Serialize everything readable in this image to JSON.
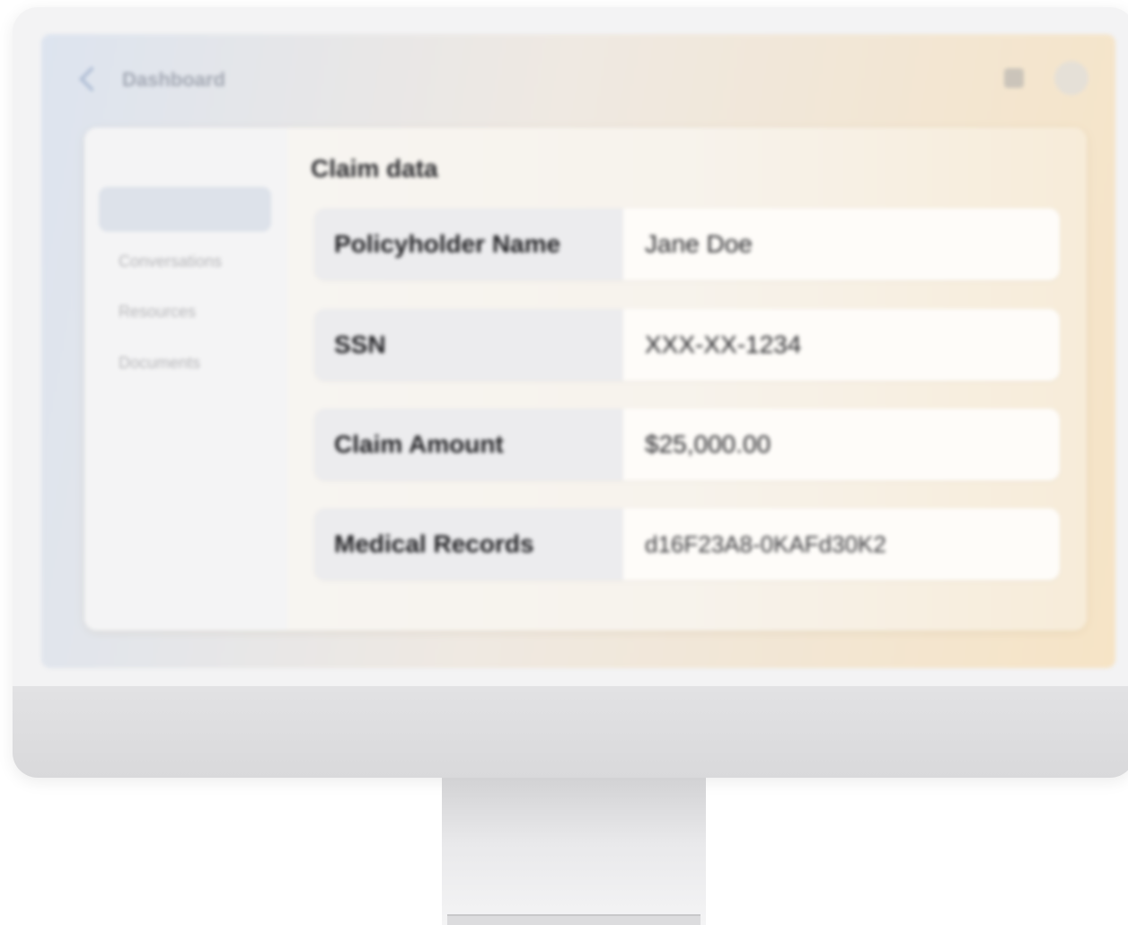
{
  "window": {
    "title": "Dashboard"
  },
  "sidebar": {
    "items": [
      {
        "label": ""
      },
      {
        "label": "Conversations"
      },
      {
        "label": "Resources"
      },
      {
        "label": "Documents"
      }
    ]
  },
  "main": {
    "section_title": "Claim data",
    "rows": [
      {
        "label": "Policyholder Name",
        "value": "Jane Doe"
      },
      {
        "label": "SSN",
        "value": "XXX-XX-1234"
      },
      {
        "label": "Claim Amount",
        "value": "$25,000.00"
      },
      {
        "label": "Medical Records",
        "value": "d16F23A8-0KAFd30K2"
      }
    ]
  },
  "colors": {
    "screen_gradient_start": "#dde4ef",
    "screen_gradient_end": "#f6e4c6",
    "label_cell": "#ececee",
    "value_cell": "#fefcf9",
    "active_sidebar": "#dde2ea"
  },
  "icons": [
    "back-arrow-icon",
    "grid-icon",
    "avatar"
  ]
}
